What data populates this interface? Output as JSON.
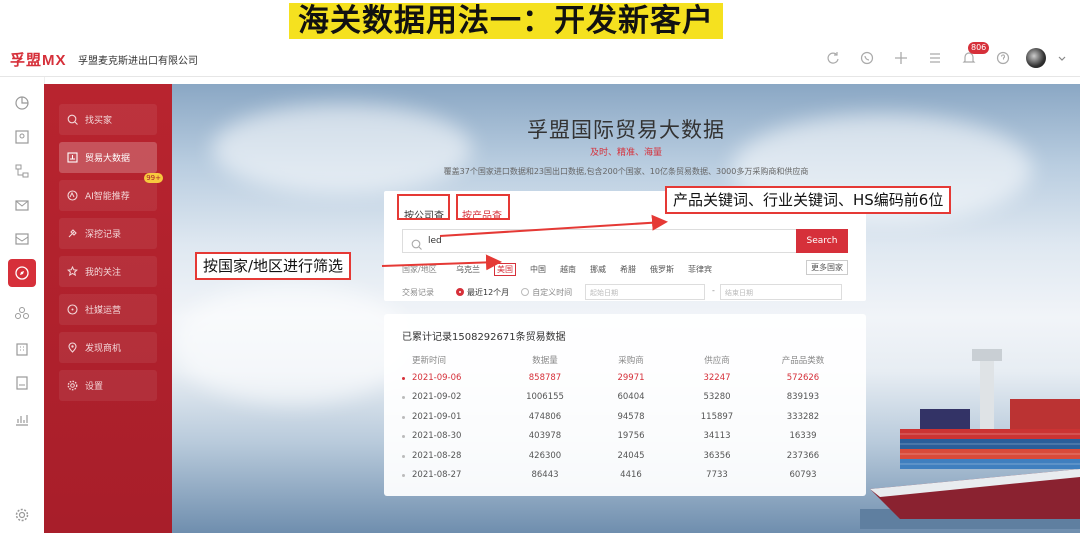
{
  "banner": {
    "title": "海关数据用法一：开发新客户"
  },
  "topbar": {
    "logo": "孚盟MX",
    "company": "孚盟麦克斯进出口有限公司",
    "notification_count": "806"
  },
  "sidebar_icons": [
    "chart-icon",
    "contact-icon",
    "tree-icon",
    "mail-icon",
    "inbox-icon",
    "compass-icon",
    "group-icon",
    "building-icon",
    "book-icon",
    "stats-icon",
    "settings-icon"
  ],
  "menu": {
    "items": [
      {
        "label": "找买家",
        "icon": "search-icon"
      },
      {
        "label": "贸易大数据",
        "icon": "data-icon"
      },
      {
        "label": "AI智能推荐",
        "icon": "ai-icon",
        "badge": "99+"
      },
      {
        "label": "深挖记录",
        "icon": "dig-icon"
      },
      {
        "label": "我的关注",
        "icon": "star-icon"
      },
      {
        "label": "社媒运营",
        "icon": "chat-icon"
      },
      {
        "label": "发现商机",
        "icon": "location-icon"
      },
      {
        "label": "设置",
        "icon": "gear-icon"
      }
    ],
    "active_index": 1
  },
  "hero": {
    "title": "孚盟国际贸易大数据",
    "subtitle": "及时、精准、海量",
    "description": "覆盖37个国家进口数据和23国出口数据,包含200个国家、10亿条贸易数据、3000多万采购商和供应商"
  },
  "search": {
    "tabs": [
      "按公司查",
      "按产品查"
    ],
    "query": "led",
    "button": "Search",
    "country_label": "国家/地区",
    "countries": [
      "乌克兰",
      "美国",
      "中国",
      "越南",
      "挪威",
      "希腊",
      "俄罗斯",
      "菲律宾"
    ],
    "selected_country": "美国",
    "more_countries": "更多国家",
    "trade_label": "交易记录",
    "range_options": [
      "最近12个月",
      "自定义时间"
    ],
    "start_placeholder": "起始日期",
    "end_placeholder": "结束日期",
    "date_separator": "-"
  },
  "stats": {
    "title": "已累计记录1508292671条贸易数据",
    "headers": [
      "更新时间",
      "数据量",
      "采购商",
      "供应商",
      "产品品类数"
    ],
    "rows": [
      [
        "2021-09-06",
        "858787",
        "29971",
        "32247",
        "572626"
      ],
      [
        "2021-09-02",
        "1006155",
        "60404",
        "53280",
        "839193"
      ],
      [
        "2021-09-01",
        "474806",
        "94578",
        "115897",
        "333282"
      ],
      [
        "2021-08-30",
        "403978",
        "19756",
        "34113",
        "16339"
      ],
      [
        "2021-08-28",
        "426300",
        "24045",
        "36356",
        "237366"
      ],
      [
        "2021-08-27",
        "86443",
        "4416",
        "7733",
        "60793"
      ]
    ]
  },
  "annotations": {
    "keyword_hint": "产品关键词、行业关键词、HS编码前6位",
    "country_hint": "按国家/地区进行筛选"
  },
  "colors": {
    "brand": "#d6303a",
    "banner": "#f5e11f",
    "menu_bg": "#b8242f"
  }
}
